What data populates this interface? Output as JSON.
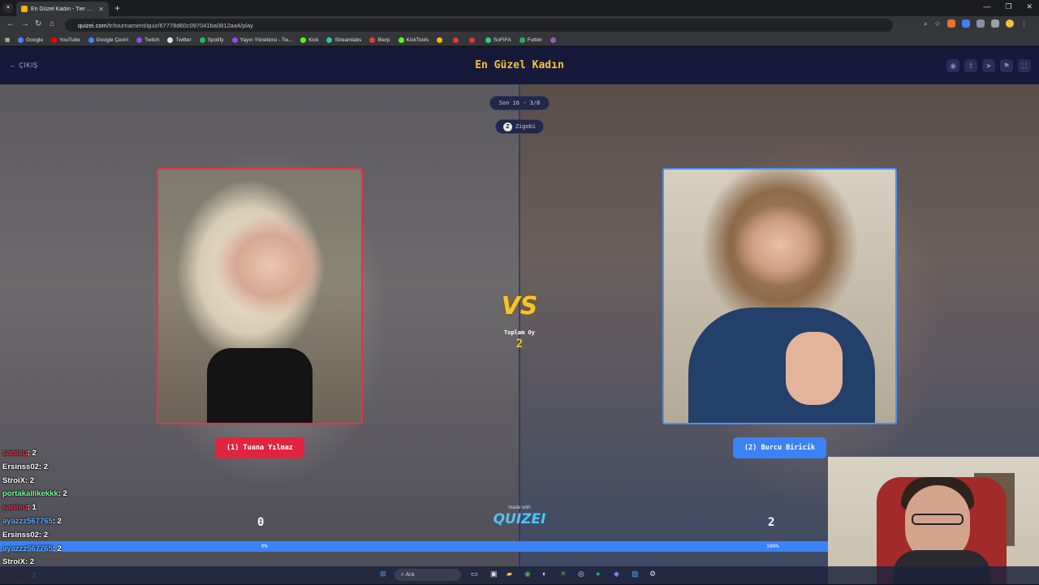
{
  "browser": {
    "tab_title": "En Güzel Kadın - Tier List, Kör S",
    "url_host": "quizei.com",
    "url_path": "/tr/tournament/quiz/67778d60c097041ba0812aa4/play",
    "bookmarks": [
      {
        "label": "Google",
        "color": "#4285f4"
      },
      {
        "label": "YouTube",
        "color": "#ff0000"
      },
      {
        "label": "Google Çeviri",
        "color": "#4285f4"
      },
      {
        "label": "Twitch",
        "color": "#9146ff"
      },
      {
        "label": "Twitter",
        "color": "#e0e0e0"
      },
      {
        "label": "Spotify",
        "color": "#1db954"
      },
      {
        "label": "Yayın Yöneticisi - Tw...",
        "color": "#9146ff"
      },
      {
        "label": "Kick",
        "color": "#53fc18"
      },
      {
        "label": "Streamlabs",
        "color": "#31c3a2"
      },
      {
        "label": "Bierp",
        "color": "#e53935"
      },
      {
        "label": "KickTools",
        "color": "#53fc18"
      },
      {
        "label": "",
        "color": "#f0b90b"
      },
      {
        "label": "",
        "color": "#e53935"
      },
      {
        "label": "",
        "color": "#e53935"
      },
      {
        "label": "SoFIFA",
        "color": "#2ecc71"
      },
      {
        "label": "Futbin",
        "color": "#27ae60"
      },
      {
        "label": "",
        "color": "#9b59b6"
      }
    ]
  },
  "header": {
    "exit_label": "ÇIKIŞ",
    "title": "En Güzel Kadın"
  },
  "match": {
    "round_label": "Son 16 - 3/8",
    "creator": "Zigobi",
    "vs": "VS",
    "total_label": "Toplam Oy",
    "total_votes": "2",
    "left": {
      "name": "(1) Tuana Yılmaz",
      "score": "0",
      "percent_label": "0%",
      "percent": 0
    },
    "right": {
      "name": "(2) Burcu Biricik",
      "score": "2",
      "percent_label": "100%",
      "percent": 100
    }
  },
  "footer": {
    "made_with": "made with",
    "brand": "QUIZEI"
  },
  "chat": [
    {
      "user": "sarılsu",
      "count": ": 2",
      "color": "#ff2b4a"
    },
    {
      "user": "Ersinss02",
      "count": ": 2",
      "color": "#ffffff"
    },
    {
      "user": "StroiX",
      "count": ": 2",
      "color": "#ffffff"
    },
    {
      "user": "portakallikekkk",
      "count": ": 2",
      "color": "#7fffa0"
    },
    {
      "user": "sarılsu",
      "count": ": 1",
      "color": "#ff2b4a"
    },
    {
      "user": "ayazzz567765",
      "count": ": 2",
      "color": "#6ab0ff"
    },
    {
      "user": "Ersinss02",
      "count": ": 2",
      "color": "#ffffff"
    },
    {
      "user": "ayazzz567765",
      "count": ": 2",
      "color": "#6ab0ff"
    },
    {
      "user": "StroiX",
      "count": ": 2",
      "color": "#ffffff"
    },
    {
      "user": "sarılsu",
      "count": ": 2",
      "color": "#ff2b4a"
    }
  ],
  "taskbar": {
    "search_label": "Ara"
  },
  "colors": {
    "accent_yellow": "#f7c233",
    "left_red": "#e0243f",
    "right_blue": "#3b82f6"
  }
}
